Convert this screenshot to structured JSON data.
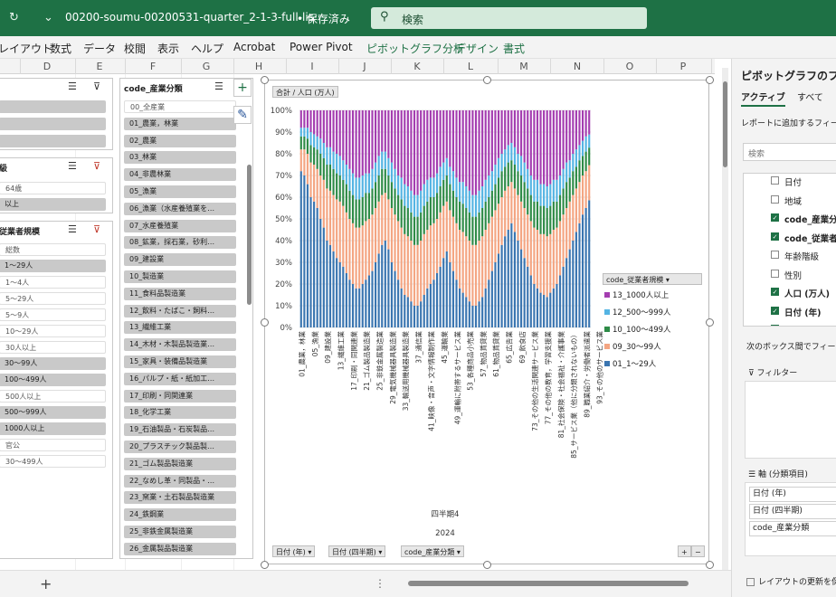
{
  "titlebar": {
    "redo_icon": "↻",
    "menu_icon": "⌄",
    "doc_title": "00200-soumu-00200531-quarter_2-1-3-full-lis···",
    "save_state": "• 保存済み",
    "search_icon": "⚲",
    "search_label": "検索"
  },
  "menubar": {
    "items": [
      "レイアウト",
      "数式",
      "データ",
      "校閲",
      "表示",
      "ヘルプ",
      "Acrobat",
      "Power Pivot",
      "ピボットグラフ分析",
      "デザイン",
      "書式"
    ]
  },
  "columns": [
    "D",
    "E",
    "F",
    "G",
    "H",
    "I",
    "J",
    "K",
    "L",
    "M",
    "N",
    "O",
    "P"
  ],
  "slicer_left": {
    "items_top": [
      "",
      "",
      ""
    ],
    "header2": "級",
    "items2": [
      "64歳",
      "以上"
    ],
    "header3": "従業者規模",
    "items3": [
      "総数",
      "1～29人",
      "1～4人",
      "5～29人",
      "5～9人",
      "10～29人",
      "30人以上",
      "30～99人",
      "100～499人",
      "500人以上",
      "500～999人",
      "1000人以上",
      "官公",
      "30～499人"
    ]
  },
  "slicer_industry": {
    "header": "code_産業分類",
    "items": [
      "00_全産業",
      "01_農業，林業",
      "02_農業",
      "03_林業",
      "04_非農林業",
      "05_漁業",
      "06_漁業（水産養殖業を…",
      "07_水産養殖業",
      "08_鉱業，採石業，砂利…",
      "09_建設業",
      "10_製造業",
      "11_食料品製造業",
      "12_飲料・たばこ・飼料…",
      "13_繊維工業",
      "14_木材・木製品製造業…",
      "15_家具・装備品製造業",
      "16_パルプ・紙・紙加工…",
      "17_印刷・同関連業",
      "18_化学工業",
      "19_石油製品・石炭製品…",
      "20_プラスチック製品製…",
      "21_ゴム製品製造業",
      "22_なめし革・同製品・…",
      "23_窯業・土石製品製造業",
      "24_鉄鋼業",
      "25_非鉄金属製造業",
      "26_金属製品製造業"
    ]
  },
  "icons": {
    "multiselect": "☰",
    "clear_filter": "⊽",
    "add": "+",
    "brush": "✎",
    "dropdown": "▾",
    "zoom_in": "+",
    "zoom_out": "−",
    "ellipsis": "⋮",
    "add_sheet": "+",
    "check": "✓"
  },
  "pivot_buttons": {
    "value_field": "合計 / 人口 (万人)",
    "axis_fields": [
      "日付 (年)",
      "日付 (四半期)",
      "code_産業分類"
    ]
  },
  "chart_data": {
    "type": "bar",
    "stacked": "100%",
    "ylim": [
      0,
      100
    ],
    "yticks": [
      "0%",
      "10%",
      "20%",
      "30%",
      "40%",
      "50%",
      "60%",
      "70%",
      "80%",
      "90%",
      "100%"
    ],
    "group_labels": [
      "四半期4",
      "2024"
    ],
    "x_tick_labels": [
      "01_農業，林業",
      "05_漁業",
      "09_建設業",
      "13_繊維工業",
      "17_印刷・同関連業",
      "21_ゴム製品製造業",
      "25_非鉄金属製造業",
      "29_電気機械器具製造業",
      "33_輸送用機械器具製造業",
      "37_通信業",
      "41_映像・音声・文字情報制作業",
      "45_運輸業",
      "49_運輸に附帯するサービス業",
      "53_各種商品小売業",
      "57_物品賃貸業",
      "61_物品賃貸業",
      "65_広告業",
      "69_飲食店",
      "73_その他の生活関連サービス業",
      "77_その他の教育，学習支援業",
      "81_社会保険・社会福祉・介護事業",
      "85_サービス業（他に分類されないもの）",
      "89_職業紹介・労働者派遣業",
      "93_その他のサービス業"
    ],
    "legend_title": "code_従業者規模",
    "series": [
      {
        "name": "01_1～29人",
        "color": "#3a75b0",
        "values": [
          72,
          70,
          66,
          60,
          58,
          55,
          50,
          46,
          40,
          38,
          35,
          32,
          30,
          28,
          25,
          22,
          20,
          18,
          18,
          20,
          22,
          24,
          26,
          30,
          34,
          38,
          40,
          36,
          30,
          26,
          22,
          18,
          15,
          14,
          12,
          10,
          10,
          12,
          15,
          18,
          20,
          22,
          25,
          28,
          32,
          35,
          30,
          26,
          22,
          18,
          16,
          14,
          12,
          10,
          10,
          12,
          14,
          18,
          22,
          26,
          30,
          34,
          38,
          42,
          45,
          48,
          44,
          40,
          36,
          32,
          28,
          24,
          20,
          18,
          16,
          15,
          14,
          16,
          18,
          20,
          24,
          28,
          32,
          36,
          40,
          44,
          48,
          52,
          55,
          58
        ]
      },
      {
        "name": "09_30～99人",
        "color": "#f4a582",
        "values": [
          10,
          12,
          14,
          16,
          17,
          18,
          20,
          22,
          24,
          25,
          26,
          27,
          28,
          28,
          28,
          28,
          28,
          28,
          28,
          27,
          27,
          26,
          26,
          25,
          24,
          23,
          22,
          23,
          25,
          26,
          27,
          28,
          28,
          28,
          28,
          28,
          28,
          28,
          28,
          27,
          27,
          26,
          25,
          25,
          24,
          23,
          24,
          25,
          26,
          27,
          28,
          28,
          28,
          28,
          28,
          28,
          28,
          27,
          26,
          25,
          24,
          23,
          22,
          21,
          20,
          19,
          20,
          21,
          22,
          23,
          24,
          25,
          26,
          27,
          27,
          28,
          28,
          27,
          27,
          26,
          25,
          24,
          23,
          22,
          21,
          20,
          19,
          18,
          17,
          16
        ]
      },
      {
        "name": "10_100～499人",
        "color": "#2e8b47",
        "values": [
          6,
          6,
          7,
          8,
          8,
          9,
          10,
          10,
          11,
          12,
          12,
          12,
          12,
          12,
          13,
          13,
          13,
          13,
          13,
          13,
          13,
          12,
          12,
          12,
          12,
          12,
          11,
          11,
          12,
          12,
          12,
          13,
          13,
          13,
          13,
          13,
          13,
          13,
          13,
          13,
          13,
          12,
          12,
          12,
          12,
          12,
          12,
          12,
          12,
          13,
          13,
          13,
          13,
          13,
          13,
          13,
          13,
          13,
          12,
          12,
          12,
          12,
          12,
          11,
          11,
          10,
          11,
          11,
          12,
          12,
          12,
          12,
          12,
          13,
          13,
          13,
          13,
          13,
          13,
          12,
          12,
          12,
          12,
          11,
          11,
          10,
          10,
          9,
          9,
          8
        ]
      },
      {
        "name": "12_500～999人",
        "color": "#54b4e3",
        "values": [
          4,
          4,
          5,
          6,
          6,
          6,
          7,
          7,
          8,
          8,
          8,
          9,
          9,
          9,
          9,
          10,
          10,
          10,
          10,
          10,
          9,
          9,
          9,
          9,
          9,
          8,
          8,
          8,
          9,
          9,
          9,
          10,
          10,
          10,
          10,
          10,
          10,
          10,
          10,
          10,
          9,
          9,
          9,
          9,
          8,
          8,
          8,
          9,
          9,
          9,
          10,
          10,
          10,
          10,
          10,
          10,
          10,
          10,
          10,
          9,
          9,
          9,
          8,
          8,
          8,
          8,
          8,
          8,
          9,
          9,
          9,
          9,
          10,
          10,
          10,
          10,
          10,
          10,
          10,
          10,
          9,
          9,
          9,
          8,
          8,
          8,
          7,
          7,
          7,
          6
        ]
      },
      {
        "name": "13_1000人以上",
        "color": "#a43db0",
        "values": [
          8,
          8,
          8,
          10,
          11,
          12,
          13,
          15,
          17,
          17,
          19,
          20,
          21,
          23,
          25,
          27,
          29,
          31,
          31,
          30,
          29,
          29,
          27,
          24,
          21,
          19,
          19,
          22,
          24,
          27,
          30,
          31,
          34,
          35,
          37,
          39,
          39,
          37,
          34,
          32,
          31,
          31,
          29,
          26,
          24,
          22,
          26,
          28,
          31,
          33,
          33,
          35,
          37,
          39,
          39,
          37,
          35,
          32,
          30,
          28,
          25,
          22,
          20,
          18,
          16,
          15,
          17,
          20,
          21,
          24,
          27,
          30,
          32,
          32,
          34,
          34,
          35,
          34,
          32,
          32,
          30,
          27,
          24,
          23,
          20,
          18,
          16,
          14,
          12,
          11
        ]
      }
    ]
  },
  "right_pane": {
    "title": "ピボットグラフのフィー…",
    "tab_active": "アクティブ",
    "tab_all": "すべて",
    "prompt": "レポートに追加するフィール…",
    "search_placeholder": "検索",
    "fields": [
      {
        "label": "日付",
        "checked": false,
        "bold": false
      },
      {
        "label": "地域",
        "checked": false,
        "bold": false
      },
      {
        "label": "code_産業分…",
        "checked": true,
        "bold": true
      },
      {
        "label": "code_従業者…",
        "checked": true,
        "bold": true
      },
      {
        "label": "年齢階級",
        "checked": false,
        "bold": false
      },
      {
        "label": "性別",
        "checked": false,
        "bold": false
      },
      {
        "label": "人口 (万人)",
        "checked": true,
        "bold": true
      },
      {
        "label": "日付 (年)",
        "checked": true,
        "bold": true
      },
      {
        "label": "日付 (四半期)",
        "checked": true,
        "bold": true
      }
    ],
    "drag_hint": "次のボックス間でフィールド…",
    "filter_label": "フィルター",
    "axis_label": "軸 (分類項目)",
    "axis_items": [
      "日付 (年)",
      "日付 (四半期)",
      "code_産業分類"
    ],
    "defer_label": "レイアウトの更新を保…"
  }
}
